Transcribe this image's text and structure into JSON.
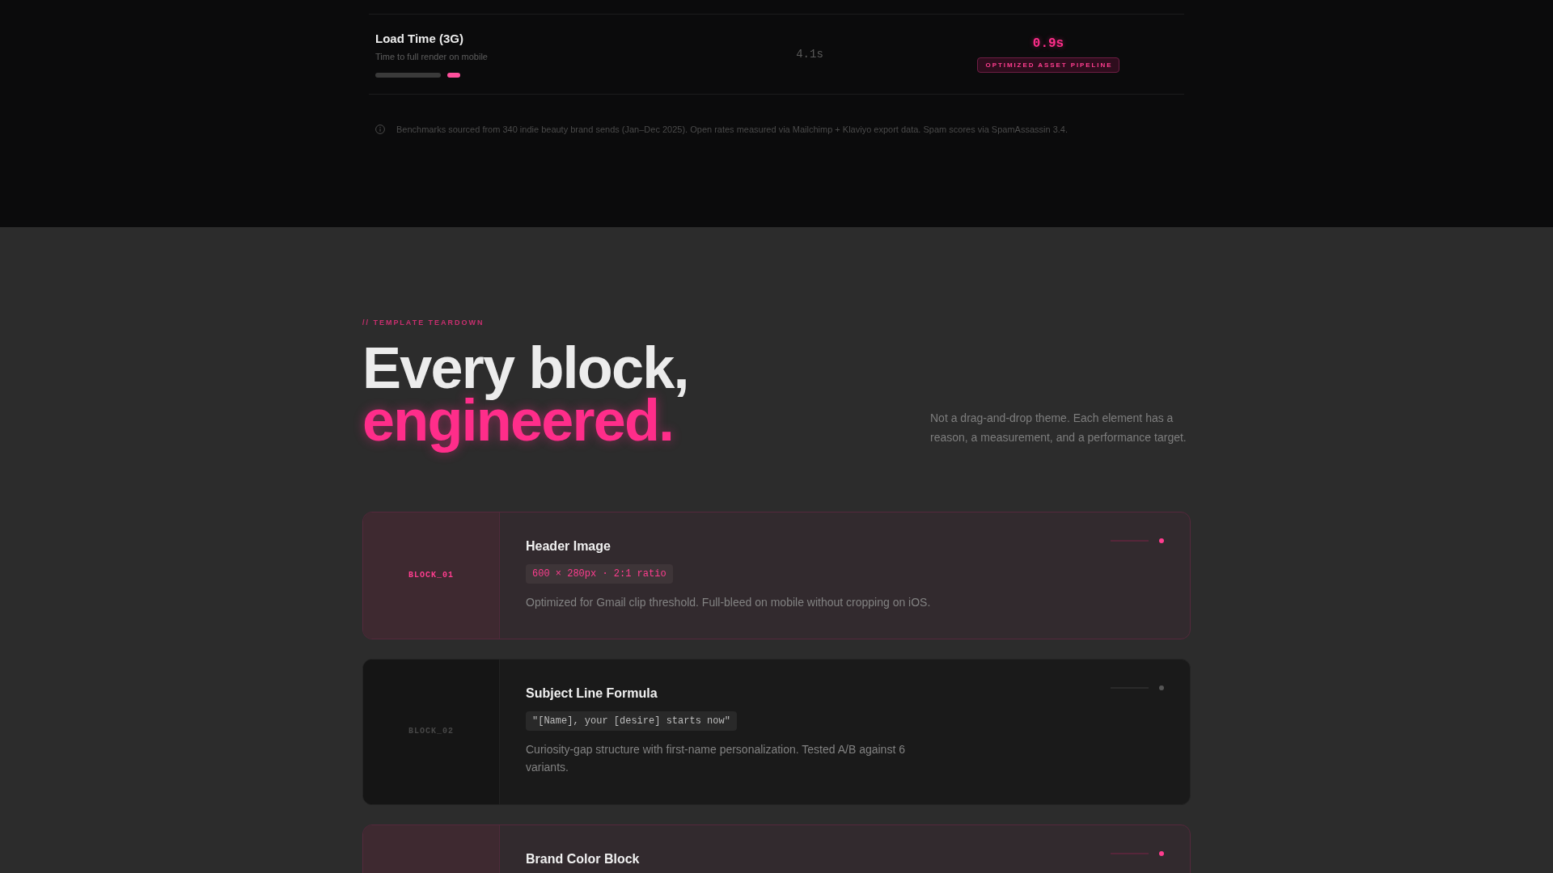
{
  "benchmark_rows": [
    {
      "metric": "Load Time (3G)",
      "description": "Time to full render on mobile",
      "before": "4.1s",
      "after": "0.9s",
      "badge": "OPTIMIZED ASSET PIPELINE"
    }
  ],
  "footnote": "Benchmarks sourced from 340 indie beauty brand sends (Jan–Dec 2025). Open rates measured via Mailchimp + Klaviyo export data. Spam scores via SpamAssassin 3.4.",
  "teardown": {
    "eyebrow": "// TEMPLATE TEARDOWN",
    "heading": [
      {
        "kind": "plain",
        "text": "Every block,"
      },
      {
        "kind": "accent",
        "text": "engineered."
      }
    ],
    "intro": "Not a drag-and-drop theme. Each element has a reason, a measurement, and a performance target.",
    "blocks": [
      {
        "label": "BLOCK_01",
        "title": "Header Image",
        "spec": "600 × 280px · 2:1 ratio",
        "description": "Optimized for Gmail clip threshold. Full-bleed on mobile without cropping on iOS.",
        "highlighted": true
      },
      {
        "label": "BLOCK_02",
        "title": "Subject Line Formula",
        "spec": "\"[Name], your [desire] starts now\"",
        "description": "Curiosity-gap structure with first-name personalization. Tested A/B against 6 variants.",
        "highlighted": false
      },
      {
        "title": "Brand Color Block",
        "highlighted": true
      }
    ]
  }
}
